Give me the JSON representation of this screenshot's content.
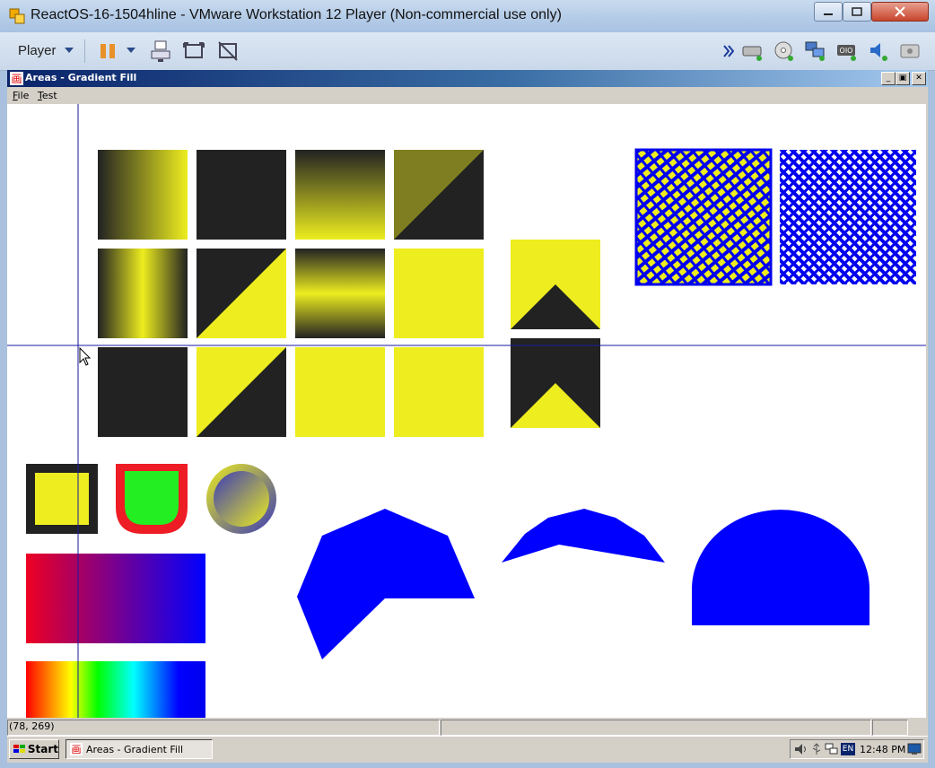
{
  "host": {
    "title": "ReactOS-16-1504hline - VMware Workstation 12 Player (Non-commercial use only)",
    "player_label": "Player",
    "toolbar_icons": [
      "pause-icon",
      "dropdown-arrow-icon",
      "send-ctrl-alt-del-icon",
      "fullscreen-icon",
      "unity-icon",
      "more-icon",
      "hard-disk-icon",
      "cd-icon",
      "network-icon",
      "usb-icon",
      "sound-icon",
      "display-icon"
    ]
  },
  "app": {
    "title": "Areas - Gradient Fill",
    "menu": [
      {
        "label": "File",
        "underline": "F",
        "rest": "ile"
      },
      {
        "label": "Test",
        "underline": "T",
        "rest": "est"
      }
    ]
  },
  "canvas": {
    "crosshair_color": "#1a1aa0",
    "yellow": "#eded1f",
    "black": "#222222",
    "blue": "#0000ff",
    "red": "#ee1c24",
    "green": "#22ee22"
  },
  "status": {
    "coords": "(78, 269)"
  },
  "taskbar": {
    "start_label": "Start",
    "task_label": "Areas - Gradient Fill",
    "lang": "EN",
    "clock": "12:48 PM"
  }
}
